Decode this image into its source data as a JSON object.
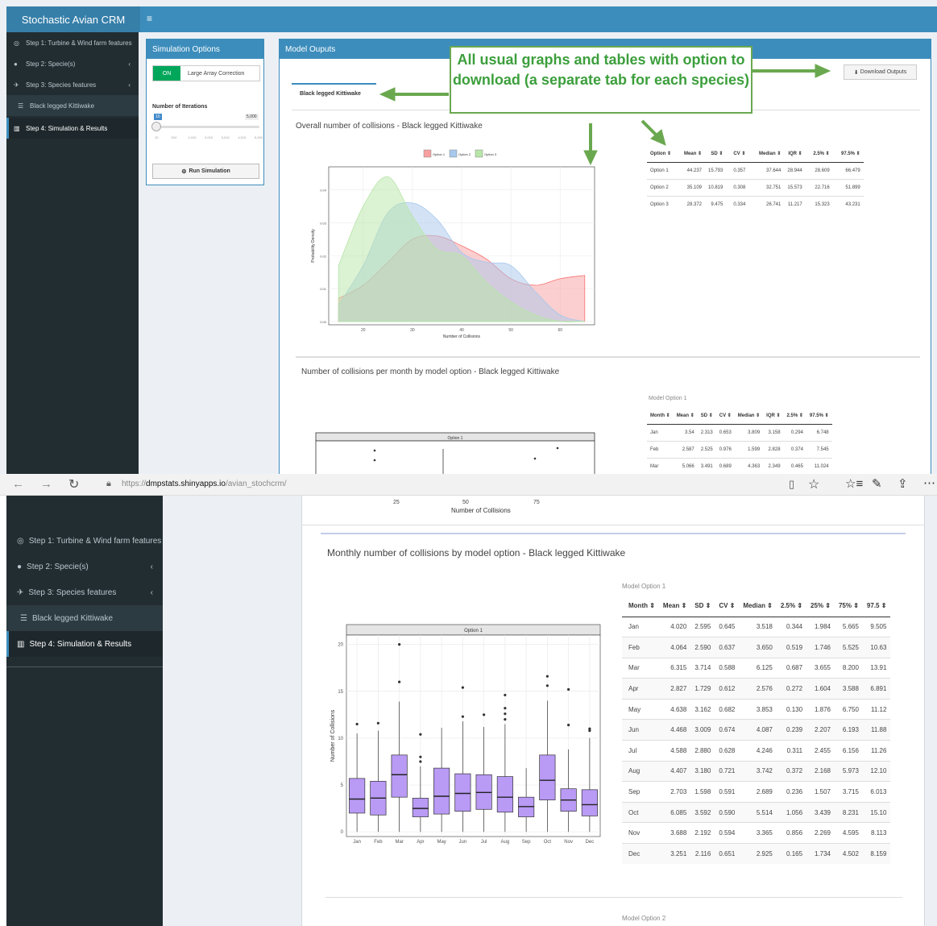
{
  "app": {
    "title": "Stochastic Avian CRM",
    "menu_icon": "≡"
  },
  "sidebar": {
    "items": [
      {
        "label": "Step 1: Turbine & Wind farm features",
        "icon": "dashboard-icon"
      },
      {
        "label": "Step 2: Specie(s)",
        "icon": "circle-icon"
      },
      {
        "label": "Step 3: Species features",
        "icon": "bird-icon"
      },
      {
        "label": "Black legged Kittiwake",
        "icon": "sliders-icon"
      },
      {
        "label": "Step 4: Simulation & Results",
        "icon": "bar-chart-icon"
      }
    ]
  },
  "sim_options": {
    "title": "Simulation Options",
    "toggle_on": "ON",
    "toggle_label": "Large Array Correction",
    "iter_label": "Number of Iterations",
    "slider_min": "10",
    "slider_max": "5,000",
    "slider_ticks": [
      "10",
      "510",
      "1,010",
      "2,010",
      "3,010",
      "4,010",
      "5,000"
    ],
    "slider_value": 10,
    "run_button": "Run Simulation"
  },
  "outputs": {
    "title": "Model Ouputs",
    "download_button": "Download Outputs",
    "tab": "Black legged Kittiwake",
    "density_title": "Overall number of collisions - Black legged Kittiwake",
    "monthly_title": "Number of collisions per month by model option - Black legged Kittiwake",
    "model_option_1": "Model Option 1"
  },
  "callout": {
    "text": "All usual graphs and tables with option to download (a separate tab for each species)"
  },
  "summary_table": {
    "headers": [
      "Option",
      "Mean",
      "SD",
      "CV",
      "Median",
      "IQR",
      "2.5%",
      "97.5%"
    ],
    "rows": [
      [
        "Option 1",
        "44.237",
        "15.793",
        "0.357",
        "37.644",
        "28.944",
        "28.609",
        "66.479"
      ],
      [
        "Option 2",
        "35.109",
        "10.819",
        "0.308",
        "32.751",
        "15.573",
        "22.716",
        "51.899"
      ],
      [
        "Option 3",
        "28.372",
        "9.475",
        "0.334",
        "26.741",
        "11.217",
        "15.323",
        "43.231"
      ]
    ]
  },
  "month_table_top": {
    "headers": [
      "Month",
      "Mean",
      "SD",
      "CV",
      "Median",
      "IQR",
      "2.5%",
      "97.5%"
    ],
    "rows": [
      [
        "Jan",
        "3.54",
        "2.313",
        "0.653",
        "3.809",
        "3.158",
        "0.294",
        "6.748"
      ],
      [
        "Feb",
        "2.587",
        "2.525",
        "0.976",
        "1.599",
        "2.828",
        "0.374",
        "7.545"
      ],
      [
        "Mar",
        "5.066",
        "3.491",
        "0.689",
        "4.363",
        "2.349",
        "0.465",
        "11.024"
      ]
    ]
  },
  "chart_data": [
    {
      "type": "area",
      "title": "",
      "xlabel": "Number of Collisions",
      "ylabel": "Probability Density",
      "xlim": [
        13,
        67
      ],
      "ylim": [
        -0.001,
        0.047
      ],
      "xticks": [
        20,
        30,
        40,
        50,
        60
      ],
      "yticks": [
        "0.00",
        "0.01",
        "0.02",
        "0.03",
        "0.04"
      ],
      "legend_position": "top",
      "x": [
        15,
        20,
        25,
        30,
        35,
        40,
        45,
        50,
        55,
        60,
        65
      ],
      "series": [
        {
          "name": "Option 1",
          "color": "#f8a0a0",
          "values": [
            0.007,
            0.011,
            0.018,
            0.025,
            0.026,
            0.023,
            0.019,
            0.013,
            0.011,
            0.013,
            0.014
          ]
        },
        {
          "name": "Option 2",
          "color": "#a8c8ec",
          "values": [
            0.005,
            0.017,
            0.033,
            0.036,
            0.031,
            0.021,
            0.018,
            0.017,
            0.009,
            0.002,
            0.0
          ]
        },
        {
          "name": "Option 3",
          "color": "#b8e6a8",
          "values": [
            0.017,
            0.035,
            0.044,
            0.032,
            0.022,
            0.02,
            0.012,
            0.006,
            0.002,
            0.0,
            0.0
          ]
        }
      ]
    },
    {
      "type": "box",
      "title": "",
      "panel_label": "Option 1",
      "xlabel": "Number of Collisions",
      "ylabel": "Number of Collisions",
      "ylim": [
        -0.5,
        21
      ],
      "yticks": [
        0,
        5,
        10,
        15,
        20
      ],
      "categories": [
        "Jan",
        "Feb",
        "Mar",
        "Apr",
        "May",
        "Jun",
        "Jul",
        "Aug",
        "Sep",
        "Oct",
        "Nov",
        "Dec"
      ],
      "color": "#b99af5",
      "boxes": [
        {
          "q1": 2,
          "median": 3.5,
          "q3": 5.7,
          "min": 0,
          "max": 10.5,
          "outliers": [
            11.5
          ]
        },
        {
          "q1": 1.8,
          "median": 3.6,
          "q3": 5.4,
          "min": 0,
          "max": 10.8,
          "outliers": [
            11.6
          ]
        },
        {
          "q1": 3.7,
          "median": 6.1,
          "q3": 8.2,
          "min": 0,
          "max": 13.9,
          "outliers": [
            16,
            20
          ]
        },
        {
          "q1": 1.6,
          "median": 2.5,
          "q3": 3.6,
          "min": 0,
          "max": 7,
          "outliers": [
            7.5,
            8,
            10.4
          ]
        },
        {
          "q1": 1.9,
          "median": 3.8,
          "q3": 6.8,
          "min": 0,
          "max": 11.1,
          "outliers": []
        },
        {
          "q1": 2.2,
          "median": 4.1,
          "q3": 6.2,
          "min": 0,
          "max": 11.8,
          "outliers": [
            12.3,
            15.4
          ]
        },
        {
          "q1": 2.4,
          "median": 4.2,
          "q3": 6.1,
          "min": 0,
          "max": 11.2,
          "outliers": [
            12.5
          ]
        },
        {
          "q1": 2.1,
          "median": 3.7,
          "q3": 5.9,
          "min": 0,
          "max": 11.5,
          "outliers": [
            12,
            12.6,
            13.2,
            14.6
          ]
        },
        {
          "q1": 1.6,
          "median": 2.7,
          "q3": 3.7,
          "min": 0,
          "max": 6.8,
          "outliers": []
        },
        {
          "q1": 3.4,
          "median": 5.5,
          "q3": 8.2,
          "min": 0,
          "max": 14,
          "outliers": [
            15.6,
            16.6
          ]
        },
        {
          "q1": 2.2,
          "median": 3.4,
          "q3": 4.6,
          "min": 0,
          "max": 8.8,
          "outliers": [
            11.4,
            15.2
          ]
        },
        {
          "q1": 1.7,
          "median": 2.9,
          "q3": 4.5,
          "min": 0,
          "max": 10,
          "outliers": [
            10.8,
            11
          ]
        }
      ]
    }
  ],
  "browser": {
    "url_prefix": "https://",
    "url_host": "dmpstats.shinyapps.io",
    "url_path": "/avian_stochcrm/"
  },
  "bottom": {
    "axis_ticks": [
      "25",
      "50",
      "75"
    ],
    "axis_label": "Number of Collisions",
    "monthly_title": "Monthly number of collisions by model option - Black legged Kittiwake",
    "model_option_1": "Model Option 1",
    "model_option_2": "Model Option 2",
    "month_table": {
      "headers": [
        "Month",
        "Mean",
        "SD",
        "CV",
        "Median",
        "2.5%",
        "25%",
        "75%",
        "97.5"
      ],
      "rows": [
        [
          "Jan",
          "4.020",
          "2.595",
          "0.645",
          "3.518",
          "0.344",
          "1.984",
          "5.665",
          "9.505"
        ],
        [
          "Feb",
          "4.064",
          "2.590",
          "0.637",
          "3.650",
          "0.519",
          "1.746",
          "5.525",
          "10.63"
        ],
        [
          "Mar",
          "6.315",
          "3.714",
          "0.588",
          "6.125",
          "0.687",
          "3.655",
          "8.200",
          "13.91"
        ],
        [
          "Apr",
          "2.827",
          "1.729",
          "0.612",
          "2.576",
          "0.272",
          "1.604",
          "3.588",
          "6.891"
        ],
        [
          "May",
          "4.638",
          "3.162",
          "0.682",
          "3.853",
          "0.130",
          "1.876",
          "6.750",
          "11.12"
        ],
        [
          "Jun",
          "4.468",
          "3.009",
          "0.674",
          "4.087",
          "0.239",
          "2.207",
          "6.193",
          "11.88"
        ],
        [
          "Jul",
          "4.588",
          "2.880",
          "0.628",
          "4.246",
          "0.311",
          "2.455",
          "6.156",
          "11.26"
        ],
        [
          "Aug",
          "4.407",
          "3.180",
          "0.721",
          "3.742",
          "0.372",
          "2.168",
          "5.973",
          "12.10"
        ],
        [
          "Sep",
          "2.703",
          "1.598",
          "0.591",
          "2.689",
          "0.236",
          "1.507",
          "3.715",
          "6.013"
        ],
        [
          "Oct",
          "6.085",
          "3.592",
          "0.590",
          "5.514",
          "1.056",
          "3.439",
          "8.231",
          "15.10"
        ],
        [
          "Nov",
          "3.688",
          "2.192",
          "0.594",
          "3.365",
          "0.856",
          "2.269",
          "4.595",
          "8.113"
        ],
        [
          "Dec",
          "3.251",
          "2.116",
          "0.651",
          "2.925",
          "0.165",
          "1.734",
          "4.502",
          "8.159"
        ]
      ]
    }
  }
}
